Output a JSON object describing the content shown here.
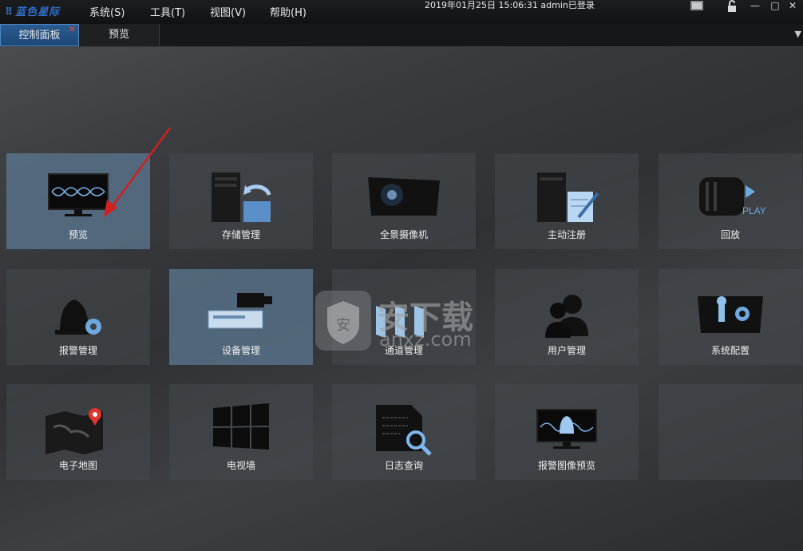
{
  "app": {
    "logo": "蓝色星际",
    "clock": "2019年01月25日 15:06:31 admin已登录"
  },
  "menu": [
    {
      "label": "系统(S)"
    },
    {
      "label": "工具(T)"
    },
    {
      "label": "视图(V)"
    },
    {
      "label": "帮助(H)"
    }
  ],
  "tabs": [
    {
      "label": "控制面板",
      "active": true
    },
    {
      "label": "预览",
      "active": false
    }
  ],
  "tiles": [
    {
      "label": "预览",
      "icon": "monitor-icon"
    },
    {
      "label": "存储管理",
      "icon": "storage-server-icon"
    },
    {
      "label": "全景摄像机",
      "icon": "panoramic-camera-icon"
    },
    {
      "label": "主动注册",
      "icon": "register-server-icon"
    },
    {
      "label": "回放",
      "icon": "film-play-icon"
    },
    {
      "label": "报警管理",
      "icon": "alarm-bell-icon"
    },
    {
      "label": "设备管理",
      "icon": "device-camera-icon"
    },
    {
      "label": "通道管理",
      "icon": "channel-icon"
    },
    {
      "label": "用户管理",
      "icon": "users-icon"
    },
    {
      "label": "系统配置",
      "icon": "system-config-icon"
    },
    {
      "label": "电子地图",
      "icon": "map-pin-icon"
    },
    {
      "label": "电视墙",
      "icon": "video-wall-icon"
    },
    {
      "label": "日志查询",
      "icon": "log-search-icon"
    },
    {
      "label": "报警图像预览",
      "icon": "alarm-image-preview-icon"
    }
  ],
  "watermark": {
    "text": "安下载",
    "sub": "anxz.com"
  },
  "colors": {
    "accent": "#2f6fc7",
    "highlight": "#5c7891",
    "arrow": "#d21f1f"
  }
}
